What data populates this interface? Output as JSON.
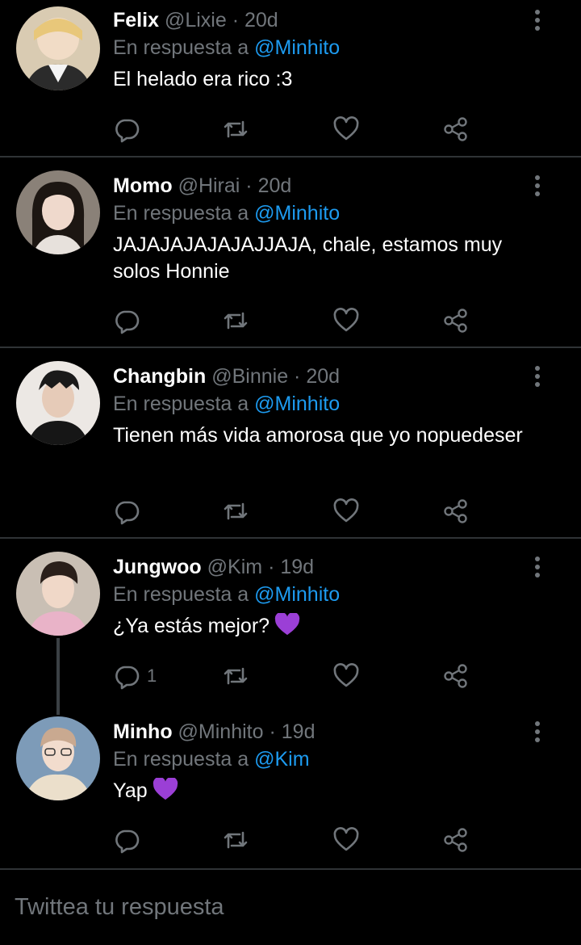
{
  "tweets": [
    {
      "name": "Felix",
      "handle": "@Lixie",
      "time": "20d",
      "reply_prefix": "En respuesta a",
      "reply_to": "@Minhito",
      "text": "El helado era rico :3",
      "reply_count": "",
      "emoji": ""
    },
    {
      "name": "Momo",
      "handle": "@Hirai",
      "time": "20d",
      "reply_prefix": "En respuesta a",
      "reply_to": "@Minhito",
      "text": "JAJAJAJAJAJAJJAJA, chale, estamos muy solos Honnie",
      "reply_count": "",
      "emoji": ""
    },
    {
      "name": "Changbin",
      "handle": "@Binnie",
      "time": "20d",
      "reply_prefix": "En respuesta a",
      "reply_to": "@Minhito",
      "text": "Tienen más vida amorosa que yo nopuedeser",
      "reply_count": "",
      "emoji": ""
    },
    {
      "name": "Jungwoo",
      "handle": "@Kim",
      "time": "19d",
      "reply_prefix": "En respuesta a",
      "reply_to": "@Minhito",
      "text": "¿Ya estás mejor?",
      "reply_count": "1",
      "emoji": "purple-heart"
    },
    {
      "name": "Minho",
      "handle": "@Minhito",
      "time": "19d",
      "reply_prefix": "En respuesta a",
      "reply_to": "@Kim",
      "text": "Yap",
      "reply_count": "",
      "emoji": "purple-heart"
    }
  ],
  "separator": "·",
  "compose": {
    "placeholder": "Twittea tu respuesta"
  },
  "icons": [
    "more-icon",
    "reply-icon",
    "retweet-icon",
    "like-icon",
    "share-icon",
    "purple-heart-emoji"
  ],
  "colors": {
    "background": "#000000",
    "text": "#ffffff",
    "muted": "#71767b",
    "mention": "#1d9bf0",
    "divider": "#2f3336",
    "emoji": "#9b3fd6"
  }
}
